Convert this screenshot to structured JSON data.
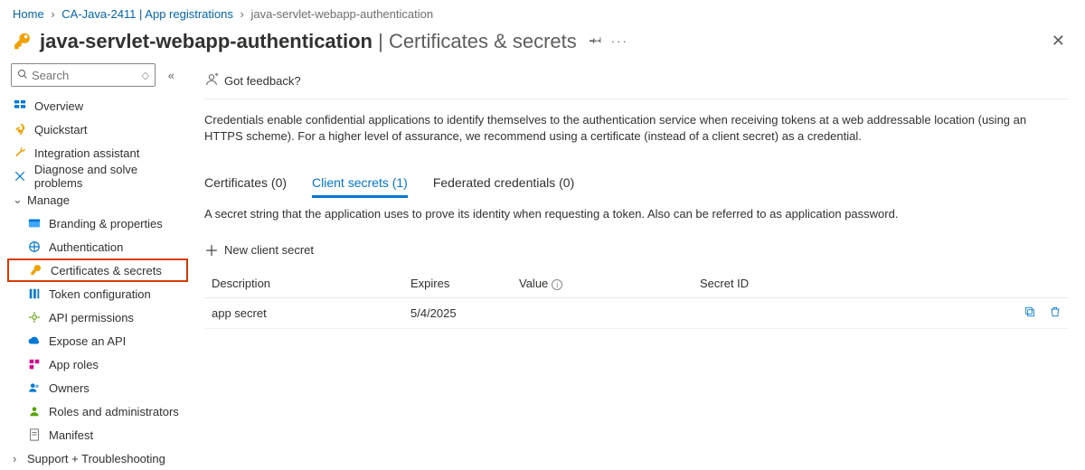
{
  "breadcrumb": {
    "home": "Home",
    "level1": "CA-Java-2411 | App registrations",
    "level2": "java-servlet-webapp-authentication"
  },
  "header": {
    "app_name": "java-servlet-webapp-authentication",
    "page_title": "Certificates & secrets",
    "pin_tooltip": "Pin",
    "more": "···"
  },
  "search": {
    "placeholder": "Search"
  },
  "sidebar": {
    "overview": "Overview",
    "quickstart": "Quickstart",
    "integration": "Integration assistant",
    "diagnose": "Diagnose and solve problems",
    "manage": "Manage",
    "branding": "Branding & properties",
    "authentication": "Authentication",
    "certs": "Certificates & secrets",
    "token": "Token configuration",
    "api_perm": "API permissions",
    "expose": "Expose an API",
    "app_roles": "App roles",
    "owners": "Owners",
    "roles_admin": "Roles and administrators",
    "manifest": "Manifest",
    "support": "Support + Troubleshooting"
  },
  "cmd": {
    "feedback": "Got feedback?"
  },
  "desc_text": "Credentials enable confidential applications to identify themselves to the authentication service when receiving tokens at a web addressable location (using an HTTPS scheme). For a higher level of assurance, we recommend using a certificate (instead of a client secret) as a credential.",
  "tabs": {
    "certificates": "Certificates (0)",
    "client_secrets": "Client secrets (1)",
    "federated": "Federated credentials (0)"
  },
  "tab_desc": "A secret string that the application uses to prove its identity when requesting a token. Also can be referred to as application password.",
  "new_secret": "New client secret",
  "table": {
    "headers": {
      "description": "Description",
      "expires": "Expires",
      "value": "Value",
      "secret_id": "Secret ID"
    },
    "rows": [
      {
        "description": "app secret",
        "expires": "5/4/2025",
        "value": "",
        "secret_id": ""
      }
    ]
  }
}
